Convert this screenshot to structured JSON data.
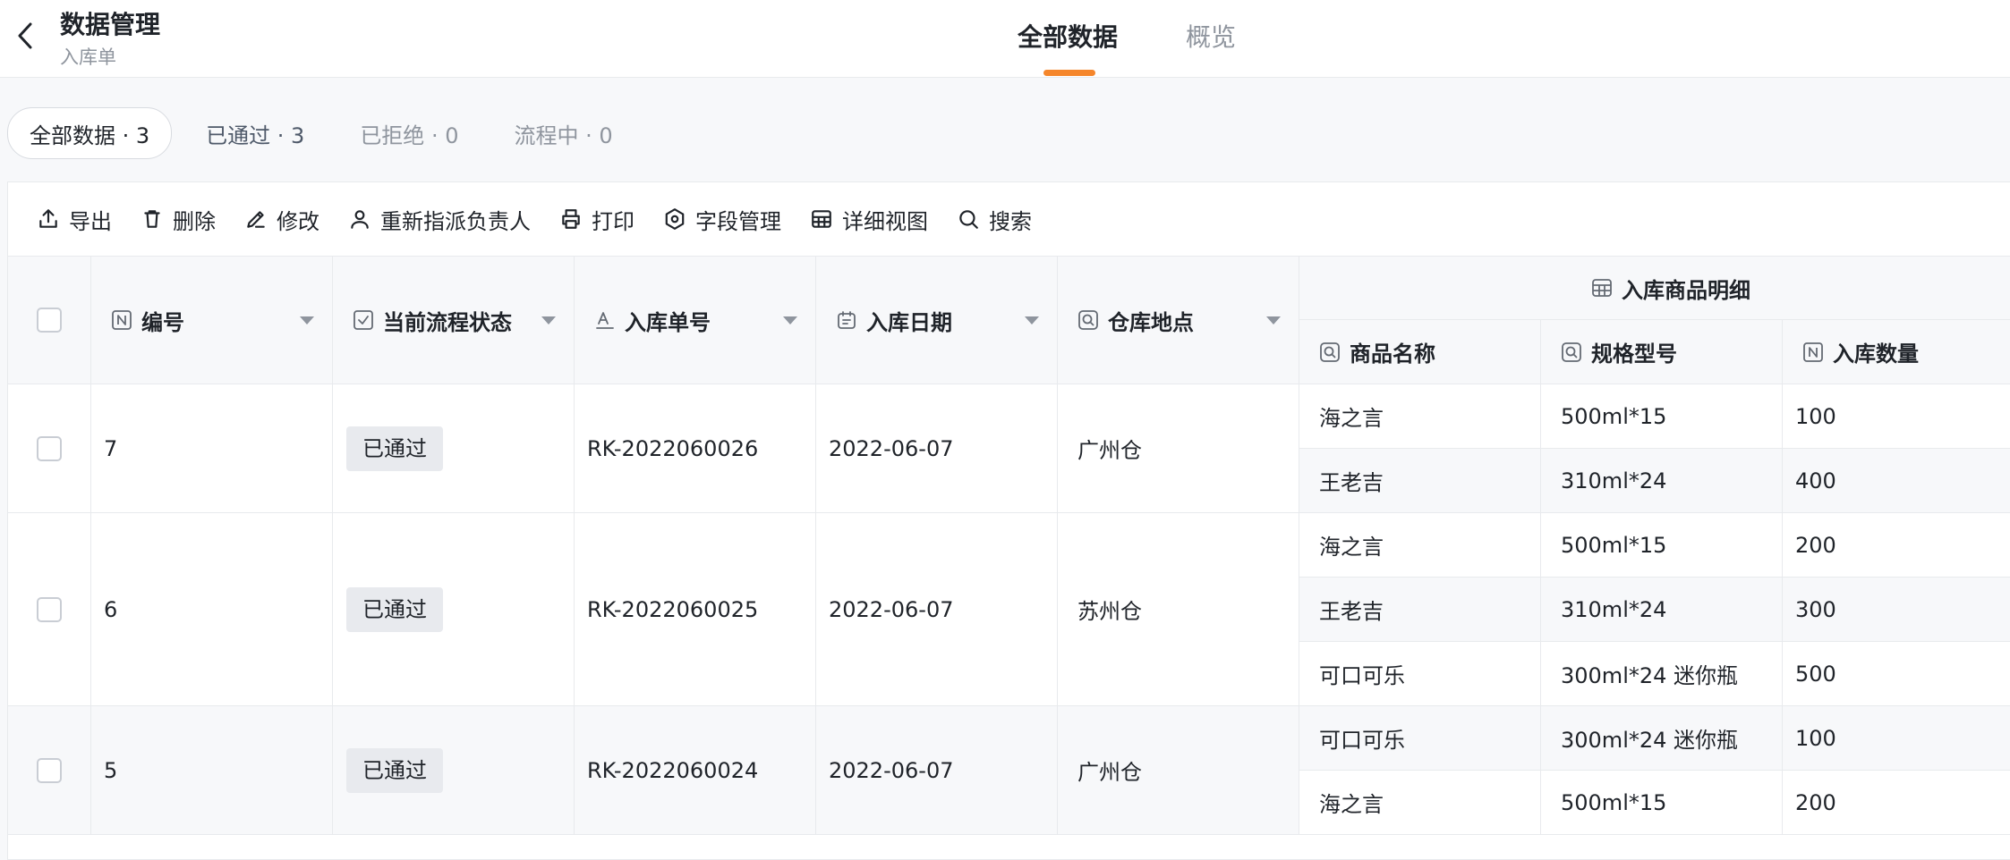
{
  "header": {
    "title": "数据管理",
    "subtitle": "入库单",
    "tabs": [
      {
        "label": "全部数据",
        "active": true
      },
      {
        "label": "概览",
        "active": false
      }
    ],
    "accent_color": "#f5862b"
  },
  "filters": [
    {
      "label": "全部数据 · 3",
      "active": true
    },
    {
      "label": "已通过 · 3",
      "active": false
    },
    {
      "label": "已拒绝 · 0",
      "active": false
    },
    {
      "label": "流程中 · 0",
      "active": false
    }
  ],
  "toolbar": [
    {
      "label": "导出",
      "icon": "export-icon"
    },
    {
      "label": "删除",
      "icon": "trash-icon"
    },
    {
      "label": "修改",
      "icon": "edit-icon"
    },
    {
      "label": "重新指派负责人",
      "icon": "user-icon"
    },
    {
      "label": "打印",
      "icon": "printer-icon"
    },
    {
      "label": "字段管理",
      "icon": "settings-icon"
    },
    {
      "label": "详细视图",
      "icon": "table-icon"
    },
    {
      "label": "搜索",
      "icon": "search-icon"
    }
  ],
  "table": {
    "columns": [
      {
        "label": "编号",
        "icon": "number-field-icon"
      },
      {
        "label": "当前流程状态",
        "icon": "checkbox-field-icon"
      },
      {
        "label": "入库单号",
        "icon": "text-field-icon"
      },
      {
        "label": "入库日期",
        "icon": "date-field-icon"
      },
      {
        "label": "仓库地点",
        "icon": "select-field-icon"
      }
    ],
    "group_header": {
      "label": "入库商品明细",
      "icon": "subtable-icon"
    },
    "sub_columns": [
      {
        "label": "商品名称",
        "icon": "select-field-icon"
      },
      {
        "label": "规格型号",
        "icon": "select-field-icon"
      },
      {
        "label": "入库数量",
        "icon": "number-field-icon"
      }
    ],
    "rows": [
      {
        "id": "7",
        "status": "已通过",
        "order_no": "RK-2022060026",
        "date": "2022-06-07",
        "warehouse": "广州仓",
        "items": [
          {
            "name": "海之言",
            "spec": "500ml*15",
            "qty": "100"
          },
          {
            "name": "王老吉",
            "spec": "310ml*24",
            "qty": "400"
          }
        ]
      },
      {
        "id": "6",
        "status": "已通过",
        "order_no": "RK-2022060025",
        "date": "2022-06-07",
        "warehouse": "苏州仓",
        "items": [
          {
            "name": "海之言",
            "spec": "500ml*15",
            "qty": "200"
          },
          {
            "name": "王老吉",
            "spec": "310ml*24",
            "qty": "300"
          },
          {
            "name": "可口可乐",
            "spec": "300ml*24 迷你瓶",
            "qty": "500"
          }
        ]
      },
      {
        "id": "5",
        "status": "已通过",
        "order_no": "RK-2022060024",
        "date": "2022-06-07",
        "warehouse": "广州仓",
        "items": [
          {
            "name": "可口可乐",
            "spec": "300ml*24 迷你瓶",
            "qty": "100"
          },
          {
            "name": "海之言",
            "spec": "500ml*15",
            "qty": "200"
          }
        ]
      }
    ]
  }
}
